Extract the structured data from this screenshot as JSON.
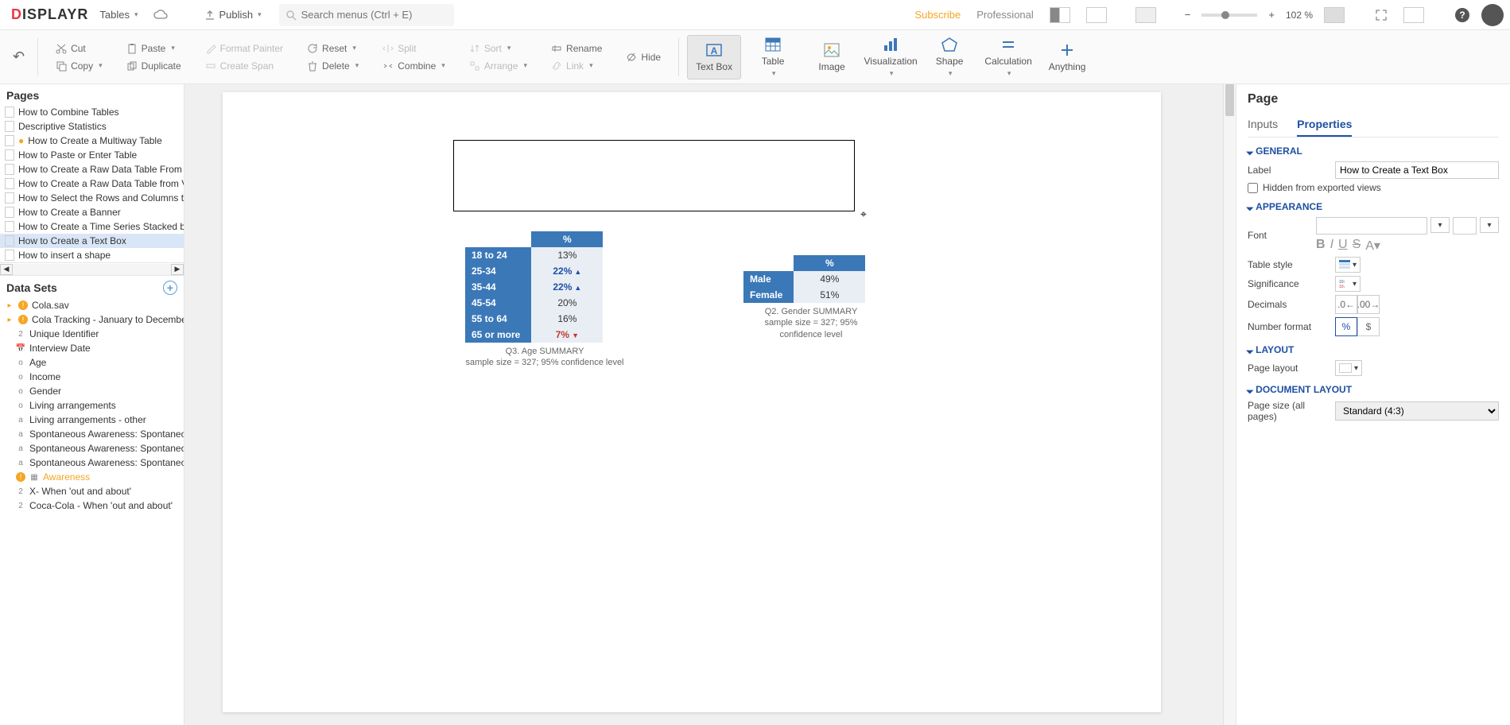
{
  "topbar": {
    "logo_prefix": "D",
    "logo_rest": "ISPLAYR",
    "tables": "Tables",
    "publish": "Publish",
    "search_placeholder": "Search menus (Ctrl + E)",
    "subscribe": "Subscribe",
    "plan": "Professional",
    "zoom_minus": "−",
    "zoom_plus": "+",
    "zoom_pct": "102 %"
  },
  "ribbon": {
    "undo": "↶",
    "cut": "Cut",
    "copy": "Copy",
    "paste": "Paste",
    "duplicate": "Duplicate",
    "format_painter": "Format Painter",
    "create_span": "Create Span",
    "reset": "Reset",
    "delete": "Delete",
    "split": "Split",
    "combine": "Combine",
    "sort": "Sort",
    "arrange": "Arrange",
    "rename": "Rename",
    "link": "Link",
    "hide": "Hide",
    "insert": {
      "textbox": "Text Box",
      "table": "Table",
      "image": "Image",
      "visualization": "Visualization",
      "shape": "Shape",
      "calculation": "Calculation",
      "anything": "Anything"
    }
  },
  "pages": {
    "title": "Pages",
    "items": [
      "How to Combine Tables",
      "Descriptive Statistics",
      "How to Create a Multiway Table",
      "How to Paste or Enter Table",
      "How to Create a Raw Data Table From a V",
      "How to Create a Raw Data Table from Var",
      "How to Select the Rows and Columns to A",
      "How to Create a Banner",
      "How to Create a Time Series Stacked by Y",
      "How to Create a Text Box",
      "How to insert a shape"
    ],
    "warn_idx": 2,
    "selected_idx": 9
  },
  "datasets": {
    "title": "Data Sets",
    "items": [
      {
        "label": "Cola.sav",
        "root": true,
        "warn": true,
        "type": ""
      },
      {
        "label": "Cola Tracking - January to December",
        "root": true,
        "warn": true,
        "type": ""
      },
      {
        "label": "Unique Identifier",
        "type": "2"
      },
      {
        "label": "Interview Date",
        "type": "cal"
      },
      {
        "label": "Age",
        "type": "o"
      },
      {
        "label": "Income",
        "type": "o"
      },
      {
        "label": "Gender",
        "type": "o"
      },
      {
        "label": "Living arrangements",
        "type": "o"
      },
      {
        "label": "Living arrangements - other",
        "type": "a"
      },
      {
        "label": "Spontaneous Awareness: Spontaneou",
        "type": "a"
      },
      {
        "label": "Spontaneous Awareness: Spontaneou",
        "type": "a"
      },
      {
        "label": "Spontaneous Awareness: Spontaneou",
        "type": "a"
      },
      {
        "label": "Awareness",
        "type": "grid",
        "hl": true,
        "warn": true
      },
      {
        "label": "X- When 'out and about'",
        "type": "2"
      },
      {
        "label": "Coca-Cola - When 'out and about'",
        "type": "2"
      }
    ]
  },
  "canvas": {
    "age_table": {
      "header": "%",
      "rows": [
        {
          "label": "18 to 24",
          "val": "13%",
          "sig": ""
        },
        {
          "label": "25-34",
          "val": "22%",
          "sig": "up"
        },
        {
          "label": "35-44",
          "val": "22%",
          "sig": "up"
        },
        {
          "label": "45-54",
          "val": "20%",
          "sig": ""
        },
        {
          "label": "55 to 64",
          "val": "16%",
          "sig": ""
        },
        {
          "label": "65 or more",
          "val": "7%",
          "sig": "down"
        }
      ],
      "caption_1": "Q3. Age SUMMARY",
      "caption_2": "sample size = 327; 95% confidence level"
    },
    "gender_table": {
      "header": "%",
      "rows": [
        {
          "label": "Male",
          "val": "49%"
        },
        {
          "label": "Female",
          "val": "51%"
        }
      ],
      "caption_1": "Q2. Gender SUMMARY",
      "caption_2": "sample size = 327; 95% confidence level"
    }
  },
  "props": {
    "panel_title": "Page",
    "tab_inputs": "Inputs",
    "tab_properties": "Properties",
    "general": "GENERAL",
    "label_lbl": "Label",
    "label_val": "How to Create a Text Box",
    "hidden": "Hidden from exported views",
    "appearance": "APPEARANCE",
    "font_lbl": "Font",
    "table_style": "Table style",
    "significance": "Significance",
    "decimals": "Decimals",
    "number_format": "Number format",
    "layout": "LAYOUT",
    "page_layout": "Page layout",
    "doc_layout": "DOCUMENT LAYOUT",
    "page_size_lbl": "Page size (all pages)",
    "page_size_val": "Standard (4:3)"
  }
}
